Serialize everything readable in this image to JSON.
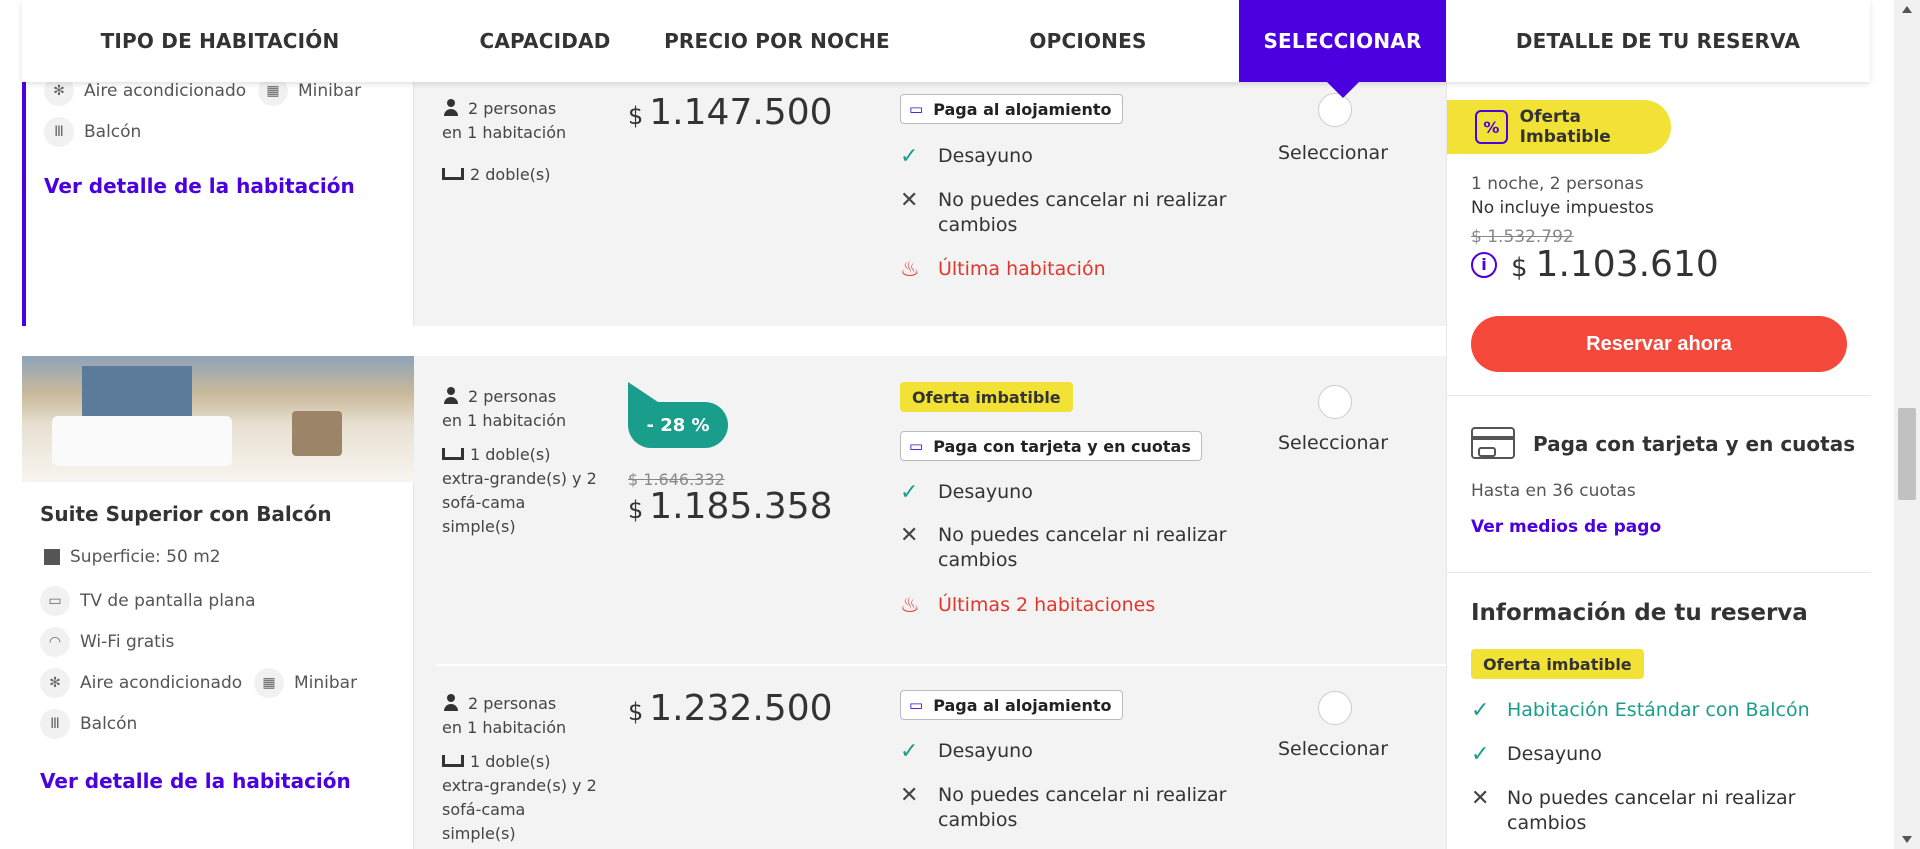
{
  "header": {
    "col_room": "TIPO DE HABITACIÓN",
    "col_capacity": "CAPACIDAD",
    "col_price": "PRECIO POR NOCHE",
    "col_options": "OPCIONES",
    "col_select": "SELECCIONAR",
    "col_detail": "DETALLE DE TU RESERVA"
  },
  "room1": {
    "amenities": [
      "Aire acondicionado",
      "Minibar",
      "Balcón"
    ],
    "detail_link": "Ver detalle de la habitación",
    "rate": {
      "capacity": "2 personas",
      "rooms": "en 1 habitación",
      "beds": "2 doble(s)",
      "currency": "$",
      "price": "1.147.500",
      "tag": "Paga al alojamiento",
      "opt_breakfast": "Desayuno",
      "opt_cancel_1": "No puedes cancelar ni realizar",
      "opt_cancel_2": "cambios",
      "alert": "Última habitación",
      "select_label": "Seleccionar"
    }
  },
  "room2": {
    "name": "Suite Superior con Balcón",
    "surface": "Superficie: 50 m2",
    "amenities": [
      "TV de pantalla plana",
      "Wi-Fi gratis",
      "Aire acondicionado",
      "Minibar",
      "Balcón"
    ],
    "detail_link": "Ver detalle de la habitación",
    "rate1": {
      "capacity": "2 personas",
      "rooms": "en 1 habitación",
      "beds_1": "1 doble(s)",
      "beds_2": "extra-grande(s) y 2",
      "beds_3": "sofá-cama",
      "beds_4": "simple(s)",
      "discount": "- 28 %",
      "old_price": "$ 1.646.332",
      "currency": "$",
      "price": "1.185.358",
      "offer_tag": "Oferta imbatible",
      "tag": "Paga con tarjeta y en cuotas",
      "opt_breakfast": "Desayuno",
      "opt_cancel_1": "No puedes cancelar ni realizar",
      "opt_cancel_2": "cambios",
      "alert": "Últimas 2 habitaciones",
      "select_label": "Seleccionar"
    },
    "rate2": {
      "capacity": "2 personas",
      "rooms": "en 1 habitación",
      "beds_1": "1 doble(s)",
      "beds_2": "extra-grande(s) y 2",
      "beds_3": "sofá-cama",
      "beds_4": "simple(s)",
      "currency": "$",
      "price": "1.232.500",
      "tag": "Paga al alojamiento",
      "opt_breakfast": "Desayuno",
      "opt_cancel_1": "No puedes cancelar ni realizar",
      "opt_cancel_2": "cambios",
      "select_label": "Seleccionar"
    }
  },
  "sidebar": {
    "offer_pill": "Oferta Imbatible",
    "nights": "1 noche, 2 personas",
    "taxes": "No incluye impuestos",
    "old_price": "$ 1.532.792",
    "currency": "$",
    "price": "1.103.610",
    "reserve_button": "Reservar ahora",
    "pay_title": "Paga con tarjeta y en cuotas",
    "pay_sub": "Hasta en 36 cuotas",
    "pay_link": "Ver medios de pago",
    "info_title": "Información de tu reserva",
    "info_tag": "Oferta imbatible",
    "info_room": "Habitación Estándar con Balcón",
    "info_breakfast": "Desayuno",
    "info_cancel_1": "No puedes cancelar ni realizar",
    "info_cancel_2": "cambios"
  },
  "colors": {
    "accent": "#4b00e0",
    "green": "#1a9e8c",
    "red": "#e0362b",
    "reserve": "#f4483a",
    "yellow": "#f2e236"
  }
}
